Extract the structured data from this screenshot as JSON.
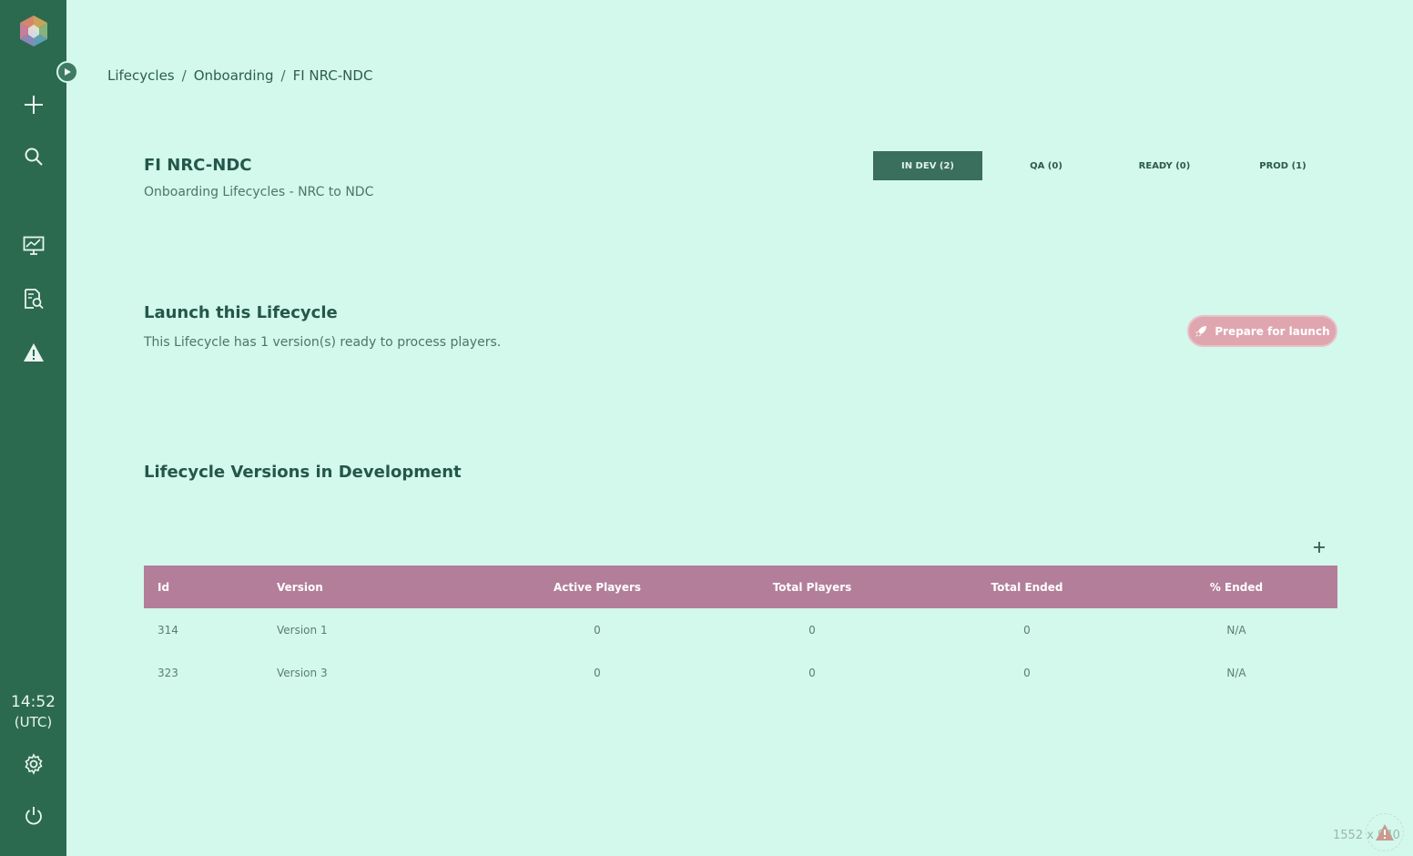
{
  "sidebar": {
    "icons": [
      "logo-icon",
      "plus-icon",
      "search-icon",
      "monitor-chart-icon",
      "document-search-icon",
      "warning-icon",
      "gear-icon",
      "power-icon"
    ],
    "clock_time": "14:52",
    "clock_tz": "(UTC)"
  },
  "breadcrumb": {
    "items": [
      "Lifecycles",
      "Onboarding",
      "FI NRC-NDC"
    ],
    "separator": "/"
  },
  "header": {
    "title": "FI NRC-NDC",
    "subtitle": "Onboarding Lifecycles - NRC to NDC"
  },
  "tabs": [
    {
      "label": "IN DEV (2)",
      "active": true
    },
    {
      "label": "QA (0)",
      "active": false
    },
    {
      "label": "READY (0)",
      "active": false
    },
    {
      "label": "PROD (1)",
      "active": false
    }
  ],
  "launch": {
    "title": "Launch this Lifecycle",
    "description": "This Lifecycle has 1 version(s) ready to process players.",
    "button_label": "Prepare for launch",
    "button_icon": "rocket-icon"
  },
  "versions": {
    "title": "Lifecycle Versions in Development",
    "add_icon": "plus-icon",
    "columns": [
      "Id",
      "Version",
      "Active Players",
      "Total Players",
      "Total Ended",
      "% Ended"
    ],
    "rows": [
      [
        "314",
        "Version 1",
        "0",
        "0",
        "0",
        "N/A"
      ],
      [
        "323",
        "Version 3",
        "0",
        "0",
        "0",
        "N/A"
      ]
    ]
  },
  "watermark": "1552 x 940",
  "colors": {
    "background": "#d3f8ec",
    "sidebar": "#2c6a50",
    "accent_tab": "#3a6e5d",
    "table_header": "#b37e9a",
    "launch_button": "#dfa6b0"
  }
}
